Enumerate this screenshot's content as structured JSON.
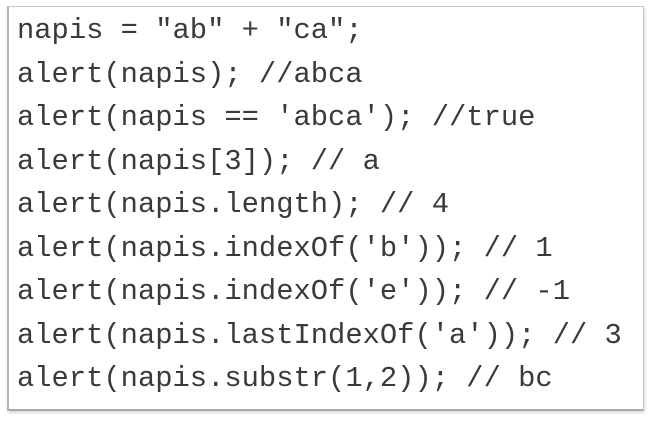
{
  "code": {
    "lines": [
      "napis = \"ab\" + \"ca\";",
      "alert(napis); //abca",
      "alert(napis == 'abca'); //true",
      "alert(napis[3]); // a",
      "alert(napis.length); // 4",
      "alert(napis.indexOf('b')); // 1",
      "alert(napis.indexOf('e')); // -1",
      "alert(napis.lastIndexOf('a')); // 3",
      "alert(napis.substr(1,2)); // bc"
    ]
  }
}
